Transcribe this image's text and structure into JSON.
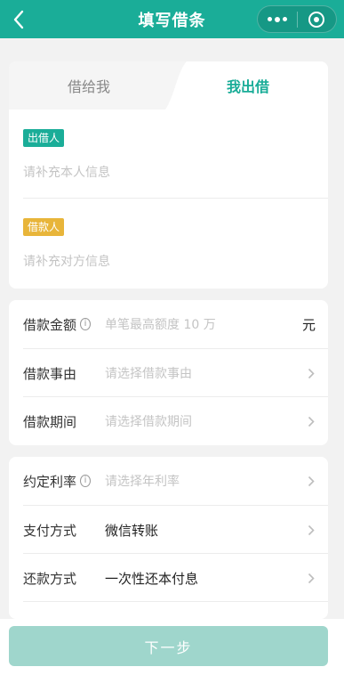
{
  "header": {
    "title": "填写借条"
  },
  "tabs": [
    {
      "label": "借给我",
      "active": false
    },
    {
      "label": "我出借",
      "active": true
    }
  ],
  "parties": {
    "lender": {
      "badge": "出借人",
      "placeholder": "请补充本人信息"
    },
    "borrower": {
      "badge": "借款人",
      "placeholder": "请补充对方信息"
    }
  },
  "loan": {
    "amount": {
      "label": "借款金额",
      "placeholder": "单笔最高额度 10 万",
      "unit": "元"
    },
    "reason": {
      "label": "借款事由",
      "placeholder": "请选择借款事由"
    },
    "period": {
      "label": "借款期间",
      "placeholder": "请选择借款期间"
    }
  },
  "terms": {
    "rate": {
      "label": "约定利率",
      "placeholder": "请选择年利率"
    },
    "payment": {
      "label": "支付方式",
      "value": "微信转账"
    },
    "repay": {
      "label": "还款方式",
      "value": "一次性还本付息"
    }
  },
  "footer": {
    "next_label": "下一步"
  },
  "colors": {
    "brand": "#1aad98",
    "borrower_badge": "#e8b53a",
    "button_disabled": "#9fd6cc"
  }
}
